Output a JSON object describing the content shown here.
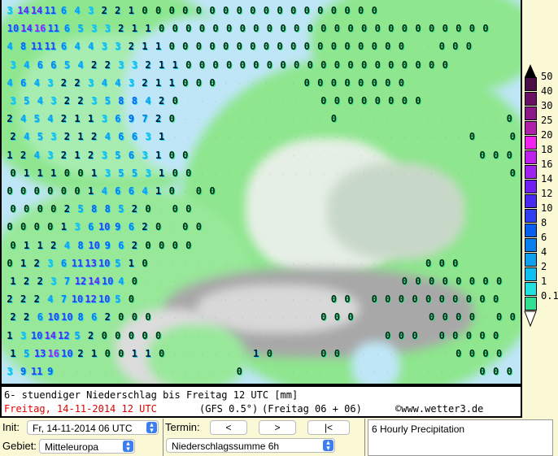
{
  "map": {
    "rows": [
      "3 14 14 11 6 4 3 2 2 1 0 0 0 0 0 0 0 0 0 0 0 0 0 0 0 0 0 0",
      "10 14 16 11 6 5 3 3 2 1 1 0 0 0 0 0 0 0 0 0 0 0 0 0 0 0 0 0 0 0 0 0 0 0 0 0",
      "4 8 11 11 6 4 4 3 3 2 1 1 0 0 0 0 0 0 0 0 0 0 0 0 0 0 0 0 0 0 . . 0 0 0",
      "3 4 6 6 5 4 2 2 3 3 2 1 1 0 0 0 0 0 0 0 0 0 0 0 0 0 0 0 0 0 0 0 0",
      "4 6 4 3 2 2 3 4 4 3 2 1 1 0 0 0 . . . . . . 0 0 0 0 0 0 0 0",
      "3 5 4 3 2 2 3 5 8 8 4 2 0 . . . . . . . . . . 0 0 0 0 0 0 0 0",
      "2 4 5 4 2 1 1 3 6 9 7 2 0 . . . . . . . . . . . 0 . . . . . . . . . . . . 0",
      "2 4 5 3 2 1 2 4 6 6 3 1 . . . . . . . . . . . . . . . . . . . . . . 0 . . 0",
      "1 2 4 3 2 1 2 3 5 6 3 1 0 0 . . . . . . . . . . . . . . . . . . . . . 0 0 0 0",
      "0 1 1 1 0 0 1 3 5 5 3 1 0 0 . . . . . . . . . . . . . . . . . . . . . . . 0",
      "0 0 0 0 0 0 1 4 6 6 4 1 0 . 0 0",
      "0 0 0 0 2 5 8 8 5 2 0 . 0 0",
      "0 0 0 0 1 3 6 10 9 6 2 0 . 0 0",
      "0 1 1 2 4 8 10 9 6 2 0 0 0 0",
      "0 1 2 3 6 11 13 10 5 1 0 . . . . . . . . . . . . . . . . . . . . 0 0 0",
      "1 2 2 3 7 12 14 10 4 0 . . . . . . . . . . . . . . . . . . . 0 0 0 0 0 0 0 0",
      "2 2 2 4 7 10 12 10 5 0 . . . . . . . . . . . . . . 0 0 . 0 0 0 0 0 0 0 0 0 0",
      "2 2 6 10 10 8 6 2 0 0 0 . . . . . . . . . . . . 0 0 0 . . . . . 0 0 0 0 . 0 0",
      "1 3 10 14 12 5 2 0 0 0 0 0 . . . . . . . . . . . . . . . . 0 0 0 . 0 0 0 0 0",
      "1 5 13 16 10 2 1 0 0 1 1 0 . . . . . . 1 0 . . . 0 0 . . . . . . . . 0 0 0 0",
      "3 9 11 9 . . . . . . . . . . . . . 0 . . . . . . . . . . . . . . . . . 0 0 0"
    ]
  },
  "legend": {
    "labels": [
      "50",
      "40",
      "30",
      "25",
      "20",
      "18",
      "16",
      "14",
      "12",
      "10",
      "8",
      "6",
      "4",
      "2",
      "1",
      "0.1"
    ],
    "colors": [
      "#4a0e44",
      "#6c1066",
      "#8c1888",
      "#b020aa",
      "#f422f0",
      "#c020ee",
      "#a022f0",
      "#7020f0",
      "#4a2af0",
      "#3040f0",
      "#0860f0",
      "#0a80f0",
      "#10a0f0",
      "#10c0f2",
      "#20e0e0",
      "#30e090"
    ]
  },
  "caption": {
    "line1": "6- stuendiger Niederschlag bis Freitag 12 UTC [mm]",
    "date": "Freitag, 14-11-2014  12 UTC",
    "model": "(GFS 0.5°)",
    "run": "(Freitag 06 + 06)",
    "copyright": "©www.wetter3.de",
    "date_color": "#e00000"
  },
  "controls": {
    "init_label": "Init:",
    "init_value": "Fr, 14-11-2014 06 UTC",
    "gebiet_label": "Gebiet:",
    "gebiet_value": "Mitteleuropa",
    "termin_label": "Termin:",
    "prev": "<",
    "next": ">",
    "first": "|<",
    "product_value": "Niederschlagssumme 6h",
    "description": "6 Hourly Precipitation"
  }
}
